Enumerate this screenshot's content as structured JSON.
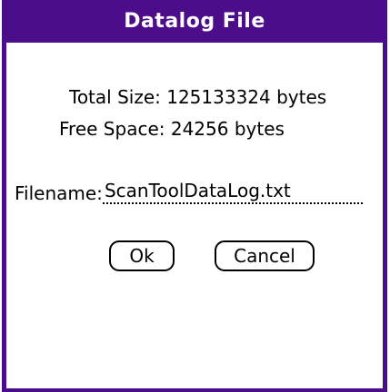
{
  "colors": {
    "frame": "#4b0d8a",
    "title_bar": "#4b0d8a",
    "title_text": "#ffffff",
    "background": "#ffffff",
    "text": "#000000"
  },
  "dialog": {
    "title": "Datalog File",
    "total_size": {
      "label": "Total Size:",
      "value": "125133324 bytes"
    },
    "free_space": {
      "label": "Free Space:",
      "value": "24256 bytes"
    },
    "filename": {
      "label": "Filename:",
      "value": "ScanToolDataLog.txt"
    },
    "buttons": {
      "ok_label": "Ok",
      "cancel_label": "Cancel"
    }
  }
}
